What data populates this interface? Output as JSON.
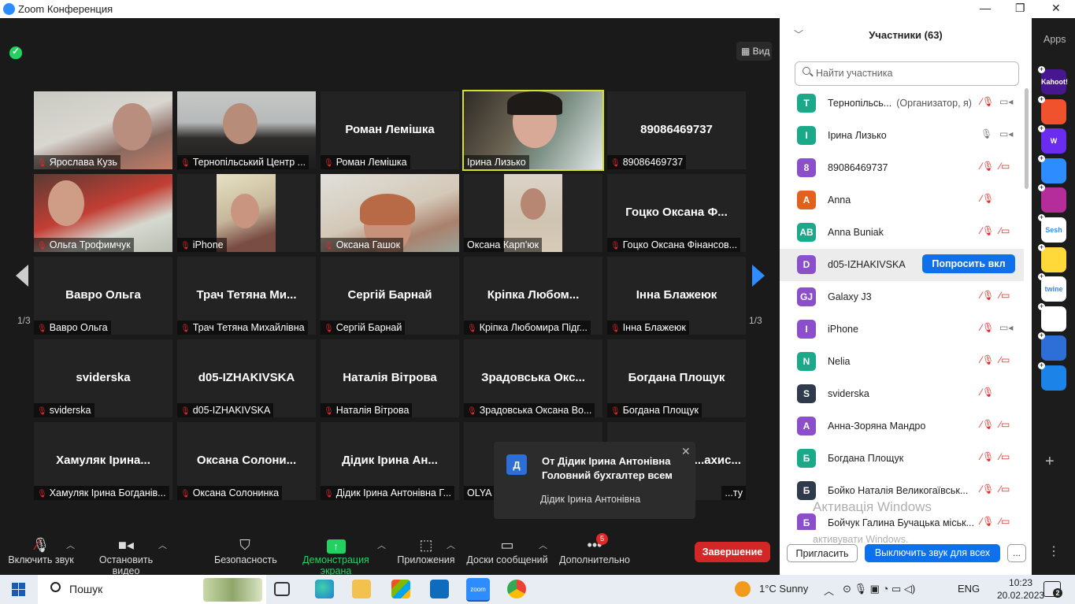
{
  "window": {
    "title": "Zoom Конференция"
  },
  "header": {
    "view_label": "Вид"
  },
  "tiles": [
    {
      "name": "Ярослава Кузь",
      "caption": "Ярослава Кузь",
      "type": "video"
    },
    {
      "name": "Тернопільський Центр ...",
      "caption": "Тернопільський Центр ...",
      "type": "video"
    },
    {
      "name": "Роман Лемішка",
      "caption": "Роман Лемішка",
      "type": "name"
    },
    {
      "name": "Ірина Лизько",
      "caption": "Ірина Лизько",
      "type": "video"
    },
    {
      "name": "89086469737",
      "caption": "89086469737",
      "type": "name"
    },
    {
      "name": "Ольга Трофимчук",
      "caption": "Ольга Трофимчук",
      "type": "video"
    },
    {
      "name": "iPhone",
      "caption": "iPhone",
      "type": "video"
    },
    {
      "name": "Оксана Гашок",
      "caption": "Оксана Гашок",
      "type": "video"
    },
    {
      "name": "Оксана Карп'юк",
      "caption": "Оксана Карп'юк",
      "type": "video"
    },
    {
      "name": "Гоцко Оксана Ф...",
      "caption": "Гоцко Оксана Фінансов...",
      "type": "name"
    },
    {
      "name": "Вавро Ольга",
      "caption": "Вавро Ольга",
      "type": "name"
    },
    {
      "name": "Трач Тетяна Ми...",
      "caption": "Трач Тетяна Михайлівна",
      "type": "name"
    },
    {
      "name": "Сергій Барнай",
      "caption": "Сергій Барнай",
      "type": "name"
    },
    {
      "name": "Кріпка Любом...",
      "caption": "Кріпка Любомира Підг...",
      "type": "name"
    },
    {
      "name": "Інна Блажеюк",
      "caption": "Інна Блажеюк",
      "type": "name"
    },
    {
      "name": "sviderska",
      "caption": "sviderska",
      "type": "name"
    },
    {
      "name": "d05-IZHAKIVSKA",
      "caption": "d05-IZHAKIVSKA",
      "type": "name"
    },
    {
      "name": "Наталія Вітрова",
      "caption": "Наталія Вітрова",
      "type": "name"
    },
    {
      "name": "Зрадовська Окс...",
      "caption": "Зрадовська Оксана Во...",
      "type": "name"
    },
    {
      "name": "Богдана Площук",
      "caption": "Богдана Площук",
      "type": "name"
    },
    {
      "name": "Хамуляк Ірина...",
      "caption": "Хамуляк Ірина Богданів...",
      "type": "name"
    },
    {
      "name": "Оксана Солони...",
      "caption": "Оксана Солонинка",
      "type": "name"
    },
    {
      "name": "Дідик Ірина Ан...",
      "caption": "Дідик Ірина Антонівна Г...",
      "type": "name"
    },
    {
      "name": "",
      "caption": "OLYA",
      "type": "name"
    },
    {
      "name": "...ахис...",
      "caption": "...ту",
      "type": "name"
    }
  ],
  "pager": {
    "left": "1/3",
    "right": "1/3"
  },
  "toast": {
    "avatar": "Д",
    "title": "От Дідик Ірина Антонівна Головний бухгалтер всем",
    "message": "Дідик Ірина Антонівна"
  },
  "toolbar": {
    "audio": "Включить звук",
    "video": "Остановить видео",
    "security": "Безопасность",
    "share": "Демонстрация экрана",
    "apps": "Приложения",
    "whiteboard": "Доски сообщений",
    "more": "Дополнительно",
    "more_badge": "5",
    "end": "Завершение"
  },
  "participants": {
    "title": "Участники (63)",
    "search_placeholder": "Найти участника",
    "ask_unmute": "Попросить вкл",
    "invite": "Пригласить",
    "mute_all": "Выключить звук для всех",
    "more": "...",
    "list": [
      {
        "initials": "T",
        "name": "Тернопільсь...",
        "role": "(Организатор, я)",
        "color": "#1ba98a",
        "mic": "off",
        "cam": "on"
      },
      {
        "initials": "I",
        "name": "Ірина Лизько",
        "role": "",
        "color": "#1ba98a",
        "mic": "on",
        "cam": "on"
      },
      {
        "initials": "8",
        "name": "89086469737",
        "role": "",
        "color": "#8b4fc9",
        "mic": "off",
        "cam": "off"
      },
      {
        "initials": "A",
        "name": "Anna",
        "role": "",
        "color": "#e0621d",
        "mic": "off",
        "cam": ""
      },
      {
        "initials": "AB",
        "name": "Anna Buniak",
        "role": "",
        "color": "#1ba98a",
        "mic": "off",
        "cam": "off"
      },
      {
        "initials": "D",
        "name": "d05-IZHAKIVSKA",
        "role": "",
        "color": "#8b4fc9",
        "mic": "",
        "cam": ""
      },
      {
        "initials": "GJ",
        "name": "Galaxy J3",
        "role": "",
        "color": "#8b4fc9",
        "mic": "off",
        "cam": "off"
      },
      {
        "initials": "I",
        "name": "iPhone",
        "role": "",
        "color": "#8b4fc9",
        "mic": "off",
        "cam": "on"
      },
      {
        "initials": "N",
        "name": "Nelia",
        "role": "",
        "color": "#1ba98a",
        "mic": "off",
        "cam": "off"
      },
      {
        "initials": "S",
        "name": "sviderska",
        "role": "",
        "color": "#2f3b4c",
        "mic": "off",
        "cam": ""
      },
      {
        "initials": "A",
        "name": "Анна-Зоряна Мандро",
        "role": "",
        "color": "#8b4fc9",
        "mic": "off",
        "cam": "off"
      },
      {
        "initials": "Б",
        "name": "Богдана Площук",
        "role": "",
        "color": "#1ba98a",
        "mic": "off",
        "cam": "off"
      },
      {
        "initials": "Б",
        "name": "Бойко Наталія Великогаївськ...",
        "role": "",
        "color": "#2f3b4c",
        "mic": "off",
        "cam": "off"
      },
      {
        "initials": "Б",
        "name": "Бойчук Галина Бучацька міськ...",
        "role": "",
        "color": "#8b4fc9",
        "mic": "off",
        "cam": "off"
      }
    ]
  },
  "watermark": {
    "line1": "Активація Windows",
    "line2": "активувати Windows."
  },
  "apps_panel": {
    "label": "Apps",
    "items": [
      {
        "name": "Kahoot!",
        "color": "#46178f"
      },
      {
        "name": "",
        "color": "#f0522d"
      },
      {
        "name": "W",
        "color": "#6a2cf0"
      },
      {
        "name": "",
        "color": "#2d8cff"
      },
      {
        "name": "",
        "color": "#b42d9a"
      },
      {
        "name": "Sesh",
        "color": "#ffffff"
      },
      {
        "name": "",
        "color": "#ffd83a"
      },
      {
        "name": "twine",
        "color": "#ffffff"
      },
      {
        "name": "",
        "color": "#ffffff"
      },
      {
        "name": "",
        "color": "#2d6fd6"
      },
      {
        "name": "",
        "color": "#1c84e8"
      }
    ]
  },
  "taskbar": {
    "search": "Пошук",
    "weather": "1°C  Sunny",
    "lang": "ENG",
    "time": "10:23",
    "date": "20.02.2023",
    "notif_count": "2"
  }
}
